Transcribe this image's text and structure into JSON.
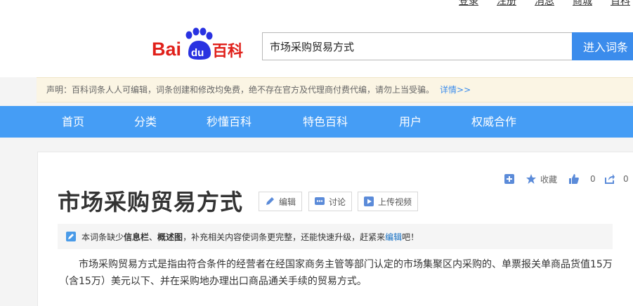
{
  "top_links": [
    "登录",
    "注册",
    "消息",
    "商城",
    "百科"
  ],
  "logo": {
    "text_bai": "Bai",
    "text_du": "du",
    "text_baike": "百科",
    "color_red": "#e0201a",
    "color_blue": "#2932e1"
  },
  "search": {
    "value": "市场采购贸易方式",
    "button_label": "进入词条"
  },
  "notice": {
    "text": "声明：百科词条人人可编辑，词条创建和修改均免费，绝不存在官方及代理商付费代编，请勿上当受骗。",
    "link": "详情>>"
  },
  "nav": {
    "items": [
      "首页",
      "分类",
      "秒懂百科",
      "特色百科",
      "用户",
      "权威合作"
    ]
  },
  "actions": {
    "add_icon": "plus-icon",
    "favorite_label": "收藏",
    "like_count": "0",
    "share_count": "0"
  },
  "entry": {
    "title": "市场采购贸易方式",
    "buttons": {
      "edit": "编辑",
      "discuss": "讨论",
      "upload_video": "上传视频"
    },
    "tip": {
      "prefix": "本词条缺少",
      "part1": "信息栏",
      "sep": "、",
      "part2": "概述图",
      "middle": "，补充相关内容使词条更完整，还能快速升级，赶紧来",
      "link": "编辑",
      "suffix": "吧！"
    },
    "description": "市场采购贸易方式是指由符合条件的经营者在经国家商务主管等部门认定的市场集聚区内采购的、单票报关单商品货值15万（含15万）美元以下、并在采购地办理出口商品通关手续的贸易方式。"
  },
  "colors": {
    "nav_bg": "#459df5",
    "search_btn": "#3b8cec",
    "notice_bg": "#fbf5e4",
    "link": "#3b8cec"
  }
}
